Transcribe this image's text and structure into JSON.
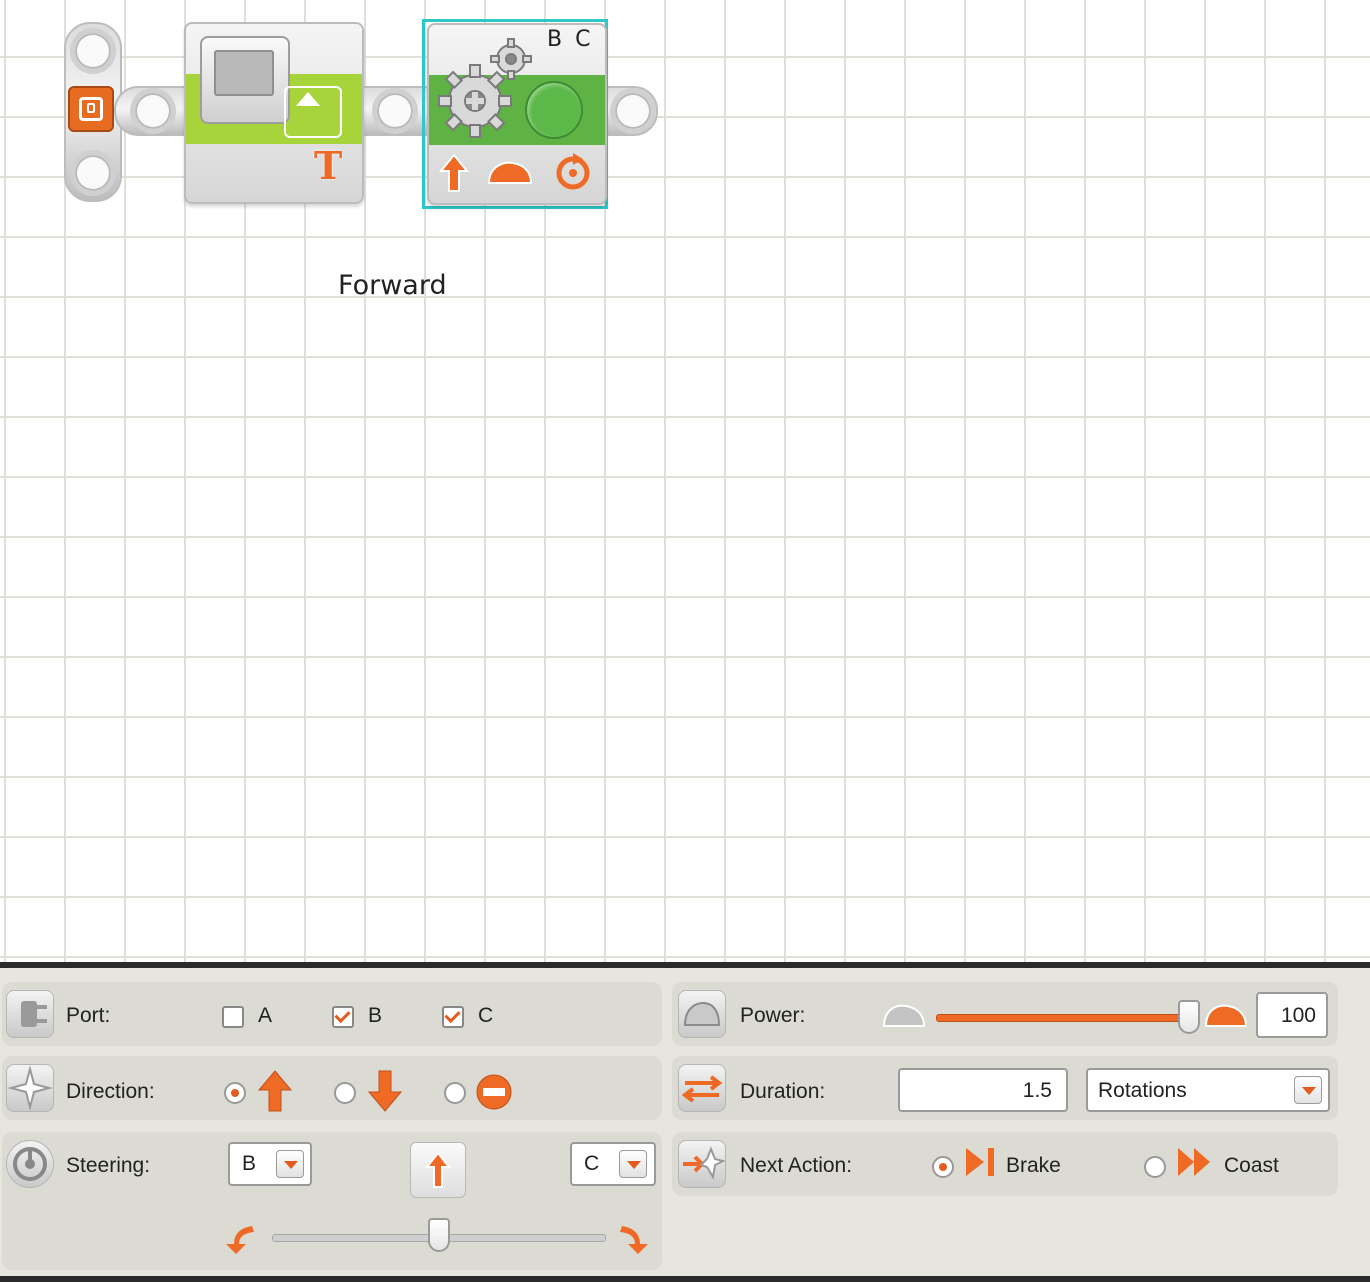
{
  "canvas": {
    "motor_ports_label": "B C",
    "block_label": "Forward"
  },
  "panel": {
    "port": {
      "label": "Port:",
      "options": [
        {
          "name": "A",
          "checked": false
        },
        {
          "name": "B",
          "checked": true
        },
        {
          "name": "C",
          "checked": true
        }
      ]
    },
    "direction": {
      "label": "Direction:",
      "selected": "forward",
      "options": [
        "forward",
        "backward",
        "stop"
      ]
    },
    "steering": {
      "label": "Steering:",
      "left_port": "B",
      "right_port": "C",
      "slider_value": 0
    },
    "power": {
      "label": "Power:",
      "value": "100",
      "slider_fraction": 1.0
    },
    "duration": {
      "label": "Duration:",
      "value": "1.5",
      "unit": "Rotations"
    },
    "next_action": {
      "label": "Next Action:",
      "options": [
        {
          "name": "Brake",
          "selected": true
        },
        {
          "name": "Coast",
          "selected": false
        }
      ]
    }
  },
  "colors": {
    "accent": "#ee6a25",
    "block_green": "#5fb244",
    "display_green": "#a6d43a",
    "selection": "#2ec7c9"
  }
}
